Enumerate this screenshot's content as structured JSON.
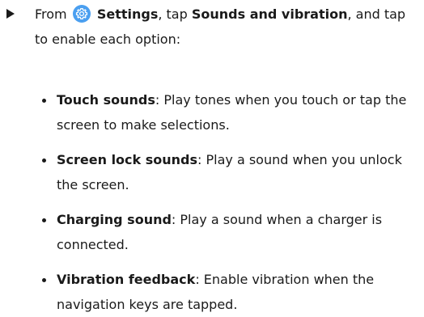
{
  "step": {
    "prefix": "From",
    "settings_icon": "gear-icon",
    "settings_label": "Settings",
    "middle": ", tap",
    "menu_label": "Sounds and vibration",
    "suffix": ", and tap to enable each option:"
  },
  "options": [
    {
      "name": "Touch sounds",
      "description": ": Play tones when you touch or tap the screen to make selections."
    },
    {
      "name": "Screen lock sounds",
      "description": ": Play a sound when you unlock the screen."
    },
    {
      "name": "Charging sound",
      "description": ": Play a sound when a charger is connected."
    },
    {
      "name": "Vibration feedback",
      "description": ": Enable vibration when the navigation keys are tapped."
    }
  ],
  "colors": {
    "text": "#1a1a1a",
    "settings_icon_bg": "#4a9ff0"
  }
}
